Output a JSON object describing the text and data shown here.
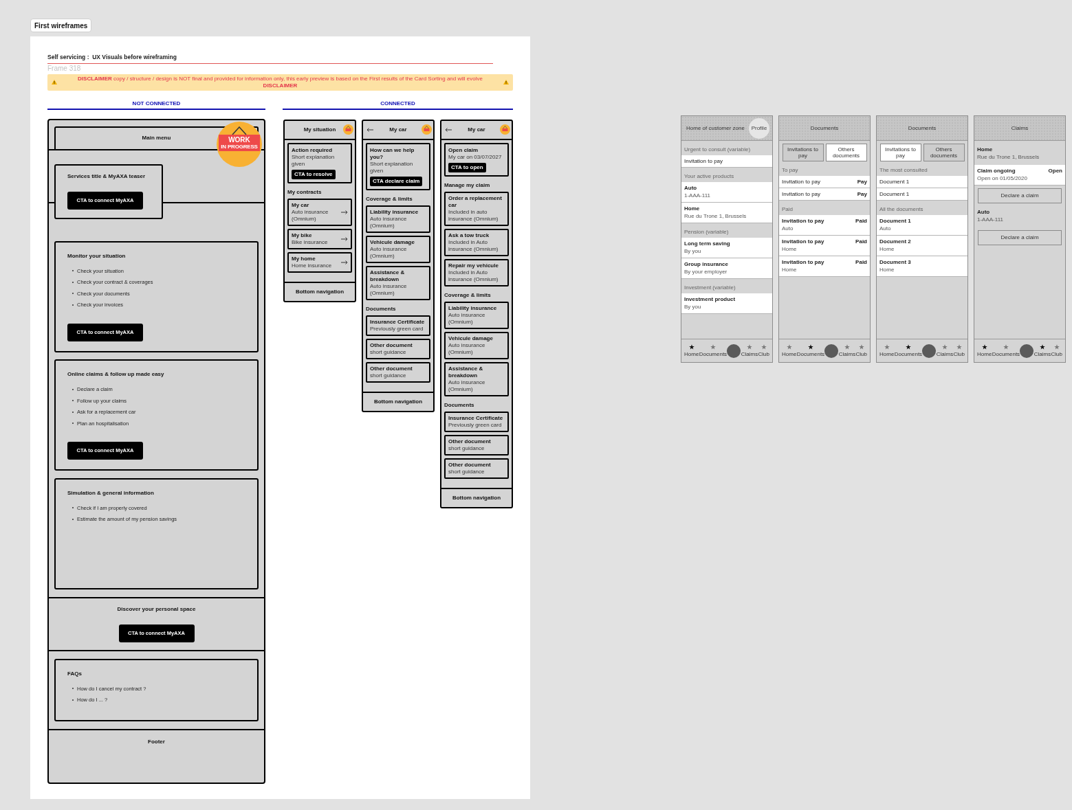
{
  "canvas_label": "First wireframes",
  "title": "Self servicing :  UX Visuals before wireframing",
  "frame_name": "Frame 318",
  "disclaimer": "**DISCLAIMER** copy / structure / design is NOT final and provided for information only, this early preview is based on the First results of the Card Sorting and will evolve **DISCLAIMER**",
  "not_connected": {
    "heading": "NOT CONNECTED",
    "main_menu": "Main menu",
    "sticker": {
      "title": "WORK",
      "subtitle": "IN PROGRESS"
    },
    "teaser": {
      "title": "Services title & MyAXA teaser",
      "cta": "CTA to connect MyAXA"
    },
    "sections": [
      {
        "title": "Monitor your situation",
        "items": [
          "Check your situation",
          "Check your contract & coverages",
          "Check your documents",
          "Check your invoices"
        ],
        "cta": "CTA to connect MyAXA"
      },
      {
        "title": "Online claims & follow up made easy",
        "items": [
          "Declare a claim",
          "Follow up your claims",
          "Ask for a replacement car",
          "Plan an hospitalisation"
        ],
        "cta": "CTA to connect MyAXA"
      },
      {
        "title": "Simulation & general information",
        "items": [
          "Check if I am properly covered",
          "Estimate the amount of my pension savings"
        ]
      }
    ],
    "discover": {
      "title": "Discover your personal space",
      "cta": "CTA to connect MyAXA"
    },
    "faqs": {
      "title": "FAQs",
      "items": [
        "How do I cancel my contract ?",
        "How do I ... ?"
      ]
    },
    "footer": "Footer"
  },
  "connected": {
    "heading": "CONNECTED",
    "screens": [
      {
        "title": "My situation",
        "back": false,
        "top_card": {
          "title": "Action required",
          "text": "Short explanation given",
          "cta": "CTA to resolve"
        },
        "groups": [
          {
            "label": "My contracts",
            "cards": [
              {
                "title": "My car",
                "subtitle": "Auto insurance (Omnium)",
                "arrow": true
              },
              {
                "title": "My bike",
                "subtitle": "Bike insurance",
                "arrow": true
              },
              {
                "title": "My home",
                "subtitle": "Home insurance",
                "arrow": true
              }
            ]
          }
        ],
        "bottom_nav": "Bottom navigation"
      },
      {
        "title": "My car",
        "back": true,
        "top_card": {
          "title": "How can we help you?",
          "text": "Short explanation given",
          "cta": "CTA declare claim"
        },
        "groups": [
          {
            "label": "Coverage & limits",
            "cards": [
              {
                "title": "Liability insurance",
                "subtitle": "Auto insurance (Omnium)",
                "arrow": false
              },
              {
                "title": "Vehicule damage",
                "subtitle": "Auto insurance (Omnium)",
                "arrow": false
              },
              {
                "title": "Assistance & breakdown",
                "subtitle": "Auto insurance (Omnium)",
                "arrow": false
              }
            ]
          },
          {
            "label": "Documents",
            "cards": [
              {
                "title": "Insurance Certificate",
                "subtitle": "Previously green card",
                "arrow": false
              },
              {
                "title": "Other document",
                "subtitle": "short guidance",
                "arrow": false
              },
              {
                "title": "Other document",
                "subtitle": "short guidance",
                "arrow": false
              }
            ]
          }
        ],
        "bottom_nav": "Bottom navigation"
      },
      {
        "title": "My car",
        "back": true,
        "top_card": {
          "title": "Open claim",
          "text": "My car on 03/07/2027",
          "cta": "CTA to open"
        },
        "groups": [
          {
            "label": "Manage my claim",
            "cards": [
              {
                "title": "Order a replacement car",
                "subtitle": "Included in auto insurance (Omnium)",
                "arrow": false
              },
              {
                "title": "Ask a tow truck",
                "subtitle": "Included in Auto insurance (Omnium)",
                "arrow": false
              },
              {
                "title": "Repair my vehicule",
                "subtitle": "Included in Auto insurance (Omnium)",
                "arrow": false
              }
            ]
          },
          {
            "label": "Coverage & limits",
            "cards": [
              {
                "title": "Liability insurance",
                "subtitle": "Auto insurance (Omnium)",
                "arrow": false
              },
              {
                "title": "Vehicule damage",
                "subtitle": "Auto insurance (Omnium)",
                "arrow": false
              },
              {
                "title": "Assistance & breakdown",
                "subtitle": "Auto insurance (Omnium)",
                "arrow": false
              }
            ]
          },
          {
            "label": "Documents",
            "cards": [
              {
                "title": "Insurance Certificate",
                "subtitle": "Previously green card",
                "arrow": false
              },
              {
                "title": "Other document",
                "subtitle": "short guidance",
                "arrow": false
              },
              {
                "title": "Other document",
                "subtitle": "short guidance",
                "arrow": false
              }
            ]
          }
        ],
        "bottom_nav": "Bottom navigation"
      }
    ]
  },
  "mockups": [
    {
      "title": "Home of customer zone",
      "profile": "Profile",
      "blocks": [
        {
          "kind": "label",
          "text": "Urgent to consult (variable)"
        },
        {
          "kind": "row",
          "title": "Invitation to pay"
        },
        {
          "kind": "label",
          "text": "Your active products"
        },
        {
          "kind": "row",
          "title": "Auto",
          "subtitle": "1-AAA-111"
        },
        {
          "kind": "row",
          "title": "Home",
          "subtitle": "Rue du Trone 1, Brussels"
        },
        {
          "kind": "label",
          "text": "Pension (variable)"
        },
        {
          "kind": "row",
          "title": "Long term saving",
          "subtitle": "By you"
        },
        {
          "kind": "row",
          "title": "Group insurance",
          "subtitle": "By your employer"
        },
        {
          "kind": "label",
          "text": "Investment (variable)"
        },
        {
          "kind": "row",
          "title": "Investment product",
          "subtitle": "By you"
        }
      ],
      "nav": [
        {
          "label": "Home",
          "selected": true
        },
        {
          "label": "Documents",
          "selected": false
        },
        {
          "label": "Claims",
          "selected": false
        },
        {
          "label": "Club",
          "selected": false
        }
      ]
    },
    {
      "title": "Documents",
      "tabs": [
        {
          "label": "Invitations to pay",
          "selected": true
        },
        {
          "label": "Others documents",
          "selected": false
        }
      ],
      "blocks": [
        {
          "kind": "label",
          "text": "To pay"
        },
        {
          "kind": "row",
          "title": "Invitation to pay",
          "value": "Pay"
        },
        {
          "kind": "row",
          "title": "Invitation to pay",
          "value": "Pay"
        },
        {
          "kind": "label",
          "text": "Paid"
        },
        {
          "kind": "row",
          "title": "Invitation to pay",
          "subtitle": "Auto",
          "value": "Paid"
        },
        {
          "kind": "row",
          "title": "Invitation to pay",
          "subtitle": "Home",
          "value": "Paid"
        },
        {
          "kind": "row",
          "title": "Invitation to pay",
          "subtitle": "Home",
          "value": "Paid"
        }
      ],
      "nav": [
        {
          "label": "Home",
          "selected": false
        },
        {
          "label": "Documents",
          "selected": true
        },
        {
          "label": "Claims",
          "selected": false
        },
        {
          "label": "Club",
          "selected": false
        }
      ]
    },
    {
      "title": "Documents",
      "tabs": [
        {
          "label": "Invitations to pay",
          "selected": false
        },
        {
          "label": "Others documents",
          "selected": true
        }
      ],
      "blocks": [
        {
          "kind": "label",
          "text": "The most consulted"
        },
        {
          "kind": "row",
          "title": "Document 1"
        },
        {
          "kind": "row",
          "title": "Document 1"
        },
        {
          "kind": "label",
          "text": "All the documents"
        },
        {
          "kind": "row",
          "title": "Document 1",
          "subtitle": "Auto"
        },
        {
          "kind": "row",
          "title": "Document 2",
          "subtitle": "Home"
        },
        {
          "kind": "row",
          "title": "Document 3",
          "subtitle": "Home"
        }
      ],
      "nav": [
        {
          "label": "Home",
          "selected": false
        },
        {
          "label": "Documents",
          "selected": true
        },
        {
          "label": "Claims",
          "selected": false
        },
        {
          "label": "Club",
          "selected": false
        }
      ]
    },
    {
      "title": "Claims",
      "blocks": [
        {
          "kind": "info",
          "title": "Home",
          "subtitle": "Rue du Trone 1, Brussels"
        },
        {
          "kind": "row",
          "title": "Claim ongoing",
          "subtitle": "Open on 01/05/2020",
          "value": "Open"
        },
        {
          "kind": "button",
          "label": "Declare a claim"
        },
        {
          "kind": "info",
          "title": "Auto",
          "subtitle": "1-AAA-111"
        },
        {
          "kind": "button",
          "label": "Declare a claim"
        }
      ],
      "nav": [
        {
          "label": "Home",
          "selected": true
        },
        {
          "label": "Documents",
          "selected": false
        },
        {
          "label": "Claims",
          "selected": true
        },
        {
          "label": "Club",
          "selected": false
        }
      ]
    }
  ]
}
